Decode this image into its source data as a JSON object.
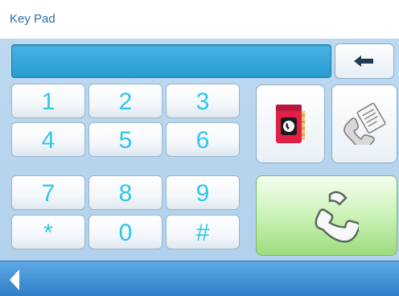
{
  "header": {
    "title": "Key Pad"
  },
  "display": {
    "value": ""
  },
  "keys": [
    {
      "label": "1",
      "name": "key-1"
    },
    {
      "label": "2",
      "name": "key-2"
    },
    {
      "label": "3",
      "name": "key-3"
    },
    {
      "label": "4",
      "name": "key-4"
    },
    {
      "label": "5",
      "name": "key-5"
    },
    {
      "label": "6",
      "name": "key-6"
    },
    {
      "label": "7",
      "name": "key-7"
    },
    {
      "label": "8",
      "name": "key-8"
    },
    {
      "label": "9",
      "name": "key-9"
    },
    {
      "label": "*",
      "name": "key-star"
    },
    {
      "label": "0",
      "name": "key-0"
    },
    {
      "label": "#",
      "name": "key-hash"
    }
  ],
  "icons": {
    "backspace": "backspace-arrow-icon",
    "phonebook": "phonebook-icon",
    "call_log": "call-log-icon",
    "call": "phone-handset-icon",
    "nav_back": "back-chevron-icon"
  },
  "colors": {
    "key_text": "#2ec7ea",
    "title": "#2c6fa8",
    "display": "#2a9ccf",
    "call_button": "#9ddc7e"
  }
}
